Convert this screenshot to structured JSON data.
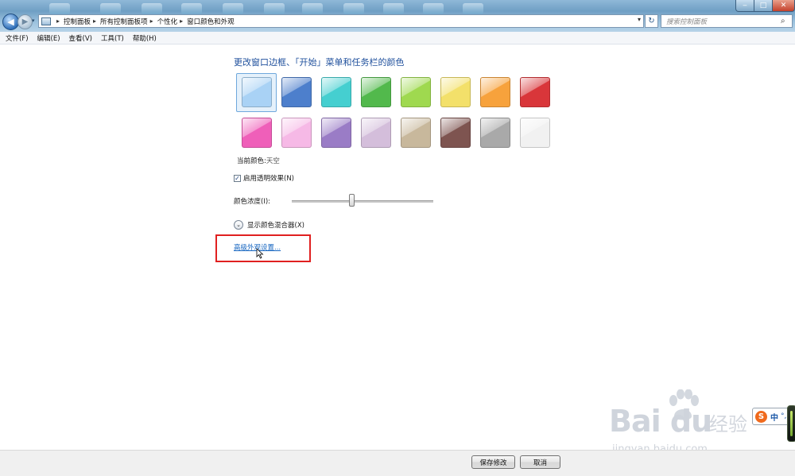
{
  "window": {
    "minimize_glyph": "‒",
    "maximize_glyph": "□",
    "close_glyph": "✕"
  },
  "nav": {
    "back_glyph": "◀",
    "forward_glyph": "▶",
    "recent_glyph": "▾"
  },
  "address": {
    "breadcrumbs": [
      "控制面板",
      "所有控制面板项",
      "个性化",
      "窗口颜色和外观"
    ],
    "separator": "▸",
    "dropdown_glyph": "▾",
    "refresh_glyph": "↻"
  },
  "search": {
    "placeholder": "搜索控制面板",
    "icon_glyph": "⌕"
  },
  "menubar": {
    "items": [
      "文件(F)",
      "编辑(E)",
      "查看(V)",
      "工具(T)",
      "帮助(H)"
    ]
  },
  "main": {
    "heading": "更改窗口边框、「开始」菜单和任务栏的颜色",
    "swatch_colors": [
      [
        "#a9d2f5",
        "#4d7fcc",
        "#45cfd0",
        "#52b94c",
        "#9fd94f",
        "#f3e06a",
        "#f7a23c",
        "#d9363a"
      ],
      [
        "#ef5fb9",
        "#f6b9e6",
        "#9a7cc6",
        "#d4bedb",
        "#c8b89c",
        "#7e5450",
        "#a9a9a9",
        "#f1f1f1"
      ]
    ],
    "selected_swatch": 0,
    "current_color_label": "当前颜色:",
    "current_color_value": "天空",
    "transparency_checked": true,
    "transparency_check_glyph": "✓",
    "transparency_label": "启用透明效果(N)",
    "intensity_label": "颜色浓度(I):",
    "intensity_level": 0.42,
    "mixer_glyph": "⌄",
    "mixer_label": "显示颜色混合器(X)",
    "advanced_link": "高级外观设置...",
    "accent_red": "#e02020",
    "link_color": "#1565c0"
  },
  "watermark": {
    "brand": "Bai  du",
    "brand_cn": "经验",
    "url": "jingyan.baidu.com"
  },
  "ime": {
    "logo": "S",
    "lang": "中",
    "dot": "°,"
  },
  "footer": {
    "save_label": "保存修改",
    "cancel_label": "取消"
  }
}
